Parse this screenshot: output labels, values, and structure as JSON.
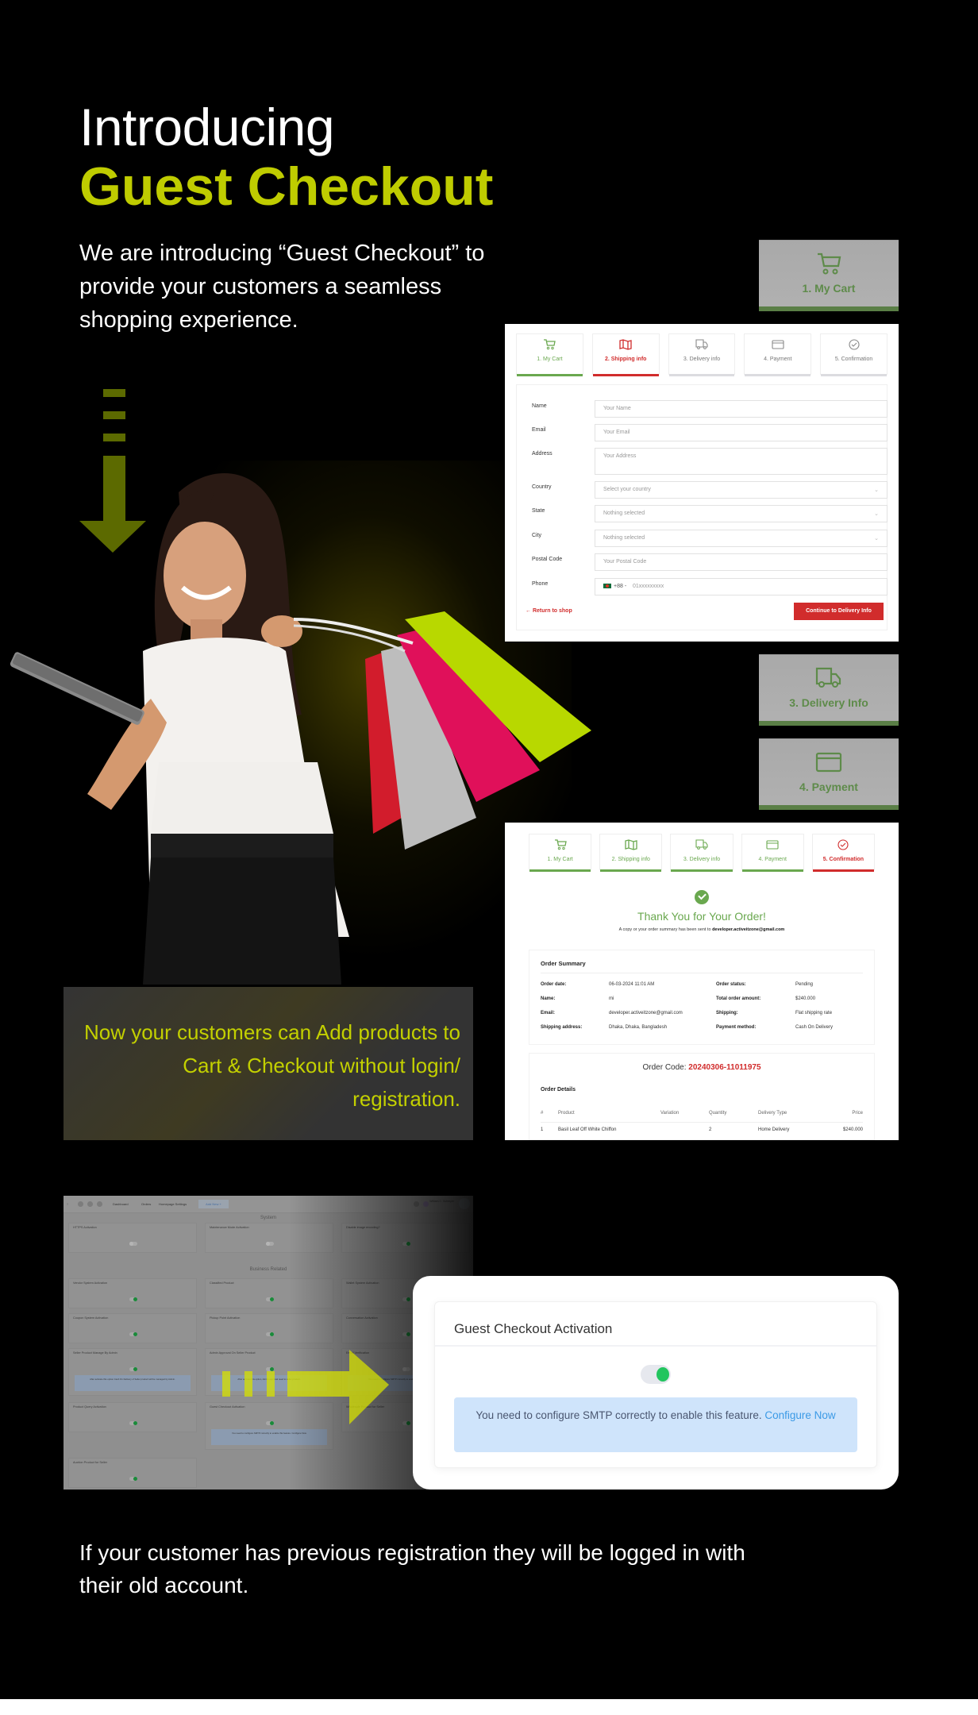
{
  "hero": {
    "title_light": "Introducing",
    "title_bold": "Guest Checkout",
    "description": "We are introducing “Guest Checkout” to provide your customers a seamless shopping experience."
  },
  "colors": {
    "accent": "#bfcc00",
    "step_done": "#6aa84f",
    "step_active": "#d12c2c",
    "toggle_on": "#22c55e",
    "alert_bg": "#cfe4fb",
    "link": "#3b9ae6"
  },
  "step_badges": [
    {
      "icon": "cart-icon",
      "label": "1. My Cart"
    },
    {
      "icon": "truck-icon",
      "label": "3. Delivery Info"
    },
    {
      "icon": "credit-card-icon",
      "label": "4. Payment"
    }
  ],
  "shipping_form": {
    "steps": [
      {
        "icon": "cart-icon",
        "label": "1. My Cart",
        "state": "done"
      },
      {
        "icon": "map-icon",
        "label": "2. Shipping info",
        "state": "active"
      },
      {
        "icon": "truck-icon",
        "label": "3. Delivery info",
        "state": "pending"
      },
      {
        "icon": "credit-card-icon",
        "label": "4. Payment",
        "state": "pending"
      },
      {
        "icon": "check-circle-icon",
        "label": "5. Confirmation",
        "state": "pending"
      }
    ],
    "fields": {
      "name": {
        "label": "Name",
        "placeholder": "Your Name"
      },
      "email": {
        "label": "Email",
        "placeholder": "Your Email"
      },
      "address": {
        "label": "Address",
        "placeholder": "Your Address"
      },
      "country": {
        "label": "Country",
        "value": "Select your country"
      },
      "state": {
        "label": "State",
        "value": "Nothing selected"
      },
      "city": {
        "label": "City",
        "value": "Nothing selected"
      },
      "postal_code": {
        "label": "Postal Code",
        "placeholder": "Your Postal Code"
      },
      "phone": {
        "label": "Phone",
        "country_code": "+88",
        "placeholder": "01xxxxxxxxx"
      }
    },
    "return_link": "← Return to shop",
    "continue_button": "Continue to Delivery Info"
  },
  "confirmation": {
    "steps": [
      {
        "icon": "cart-icon",
        "label": "1. My Cart",
        "state": "done"
      },
      {
        "icon": "map-icon",
        "label": "2. Shipping info",
        "state": "done"
      },
      {
        "icon": "truck-icon",
        "label": "3. Delivery info",
        "state": "done"
      },
      {
        "icon": "credit-card-icon",
        "label": "4. Payment",
        "state": "done"
      },
      {
        "icon": "check-circle-icon",
        "label": "5. Confirmation",
        "state": "active"
      }
    ],
    "title": "Thank You for Your Order!",
    "copy_prefix": "A copy or your order summary has been sent to",
    "copy_email": "developer.activeitzone@gmail.com",
    "summary": {
      "title": "Order Summary",
      "left": [
        {
          "key": "Order date:",
          "value": "06-03-2024 11:01 AM"
        },
        {
          "key": "Name:",
          "value": "mi"
        },
        {
          "key": "Email:",
          "value": "developer.activeitzone@gmail.com"
        },
        {
          "key": "Shipping address:",
          "value": "Dhaka, Dhaka, Bangladesh"
        }
      ],
      "right": [
        {
          "key": "Order status:",
          "value": "Pending"
        },
        {
          "key": "Total order amount:",
          "value": "$240.000"
        },
        {
          "key": "Shipping:",
          "value": "Flat shipping rate"
        },
        {
          "key": "Payment method:",
          "value": "Cash On Delivery"
        }
      ]
    },
    "order_code_label": "Order Code:",
    "order_code": "20240306-11011975",
    "details_title": "Order Details",
    "table": {
      "headers": [
        "#",
        "Product",
        "Variation",
        "Quantity",
        "Delivery Type",
        "Price"
      ],
      "rows": [
        [
          "1",
          "Basil Leaf Off White Chiffon",
          "",
          "2",
          "Home Delivery",
          "$240.000"
        ]
      ]
    }
  },
  "highlight": {
    "text": "Now your customers can Add products to Cart & Checkout without login/ registration."
  },
  "admin": {
    "nav": [
      "Dashboard",
      "Orders",
      "Homepage Settings"
    ],
    "add_new": "Add New +",
    "user_name": "William C. Schreyer",
    "user_role": "admin",
    "sections": [
      "System",
      "Business Related"
    ],
    "settings": [
      {
        "label": "HTTPS Activation",
        "on": false
      },
      {
        "label": "Maintenance Mode Activation",
        "on": false
      },
      {
        "label": "Disable image encoding?",
        "on": true
      },
      {
        "label": "Vendor System Activation",
        "on": true
      },
      {
        "label": "Classified Product",
        "on": true
      },
      {
        "label": "Wallet System Activation",
        "on": true
      },
      {
        "label": "Coupon System Activation",
        "on": true
      },
      {
        "label": "Pickup Point Activation",
        "on": true
      },
      {
        "label": "Conversation Activation",
        "on": true
      },
      {
        "label": "Seller Product Manage By Admin",
        "on": true,
        "note": "After activate this option Cash On Delivery of Seller product will be managed by Admin."
      },
      {
        "label": "Admin Approval On Seller Product",
        "on": true,
        "note": "After activate this option, Admin approval need to seller product."
      },
      {
        "label": "Email Verification",
        "on": false,
        "note": "You need to configure SMTP correctly to enable this feature. Configure Now"
      },
      {
        "label": "Product Query Activation",
        "on": true
      },
      {
        "label": "Guest Checkout Activation",
        "on": true,
        "note": "You need to configure SMTP correctly to enable this feature. Configure Now"
      },
      {
        "label": "Wholesale Product for Seller",
        "on": true
      },
      {
        "label": "Auction Product for Seller",
        "on": true
      }
    ]
  },
  "modal": {
    "title": "Guest Checkout Activation",
    "toggle_on": true,
    "alert_text": "You need to configure SMTP correctly to enable this feature.",
    "alert_link": "Configure Now"
  },
  "footer_text": "If your customer has previous registration they will be logged in with their old account."
}
